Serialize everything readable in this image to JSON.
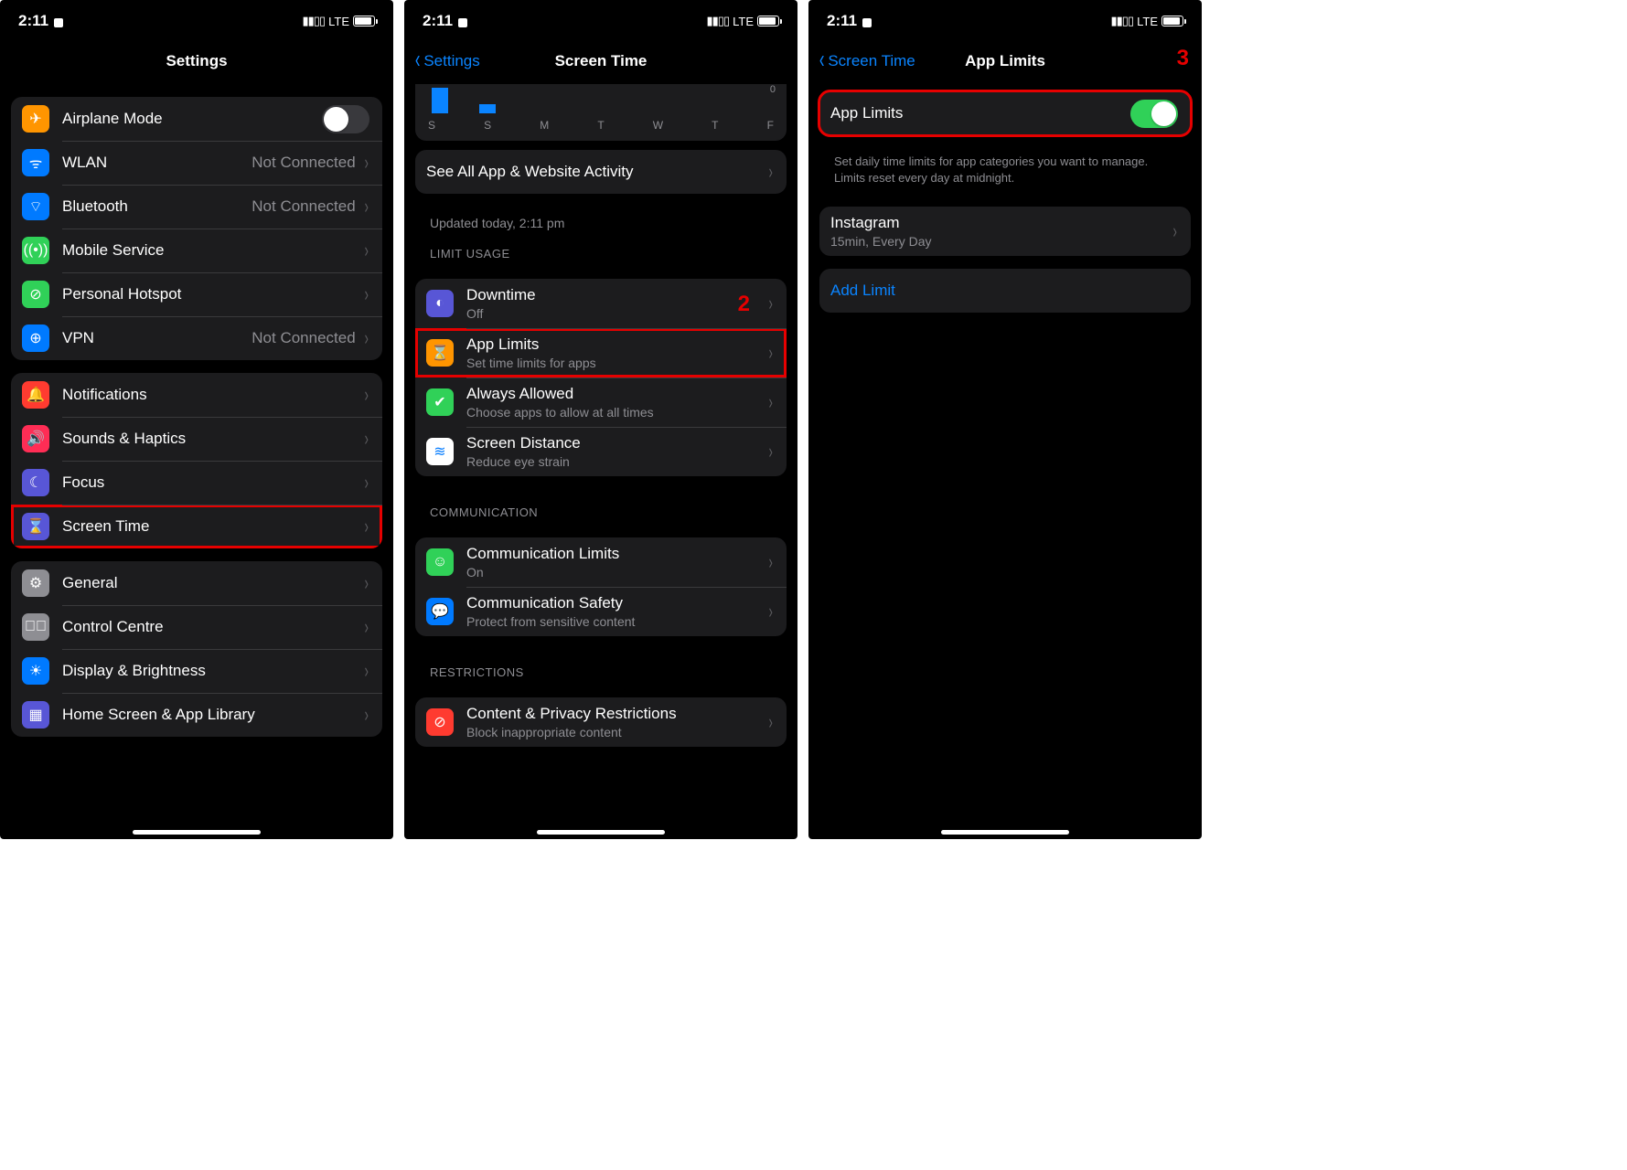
{
  "status": {
    "time": "2:11",
    "network": "LTE"
  },
  "screen1": {
    "title": "Settings",
    "group1": [
      {
        "icon": "airplane",
        "color": "#ff9500",
        "label": "Airplane Mode",
        "type": "toggle",
        "on": false
      },
      {
        "icon": "wifi",
        "color": "#007aff",
        "label": "WLAN",
        "value": "Not Connected"
      },
      {
        "icon": "bluetooth",
        "color": "#007aff",
        "label": "Bluetooth",
        "value": "Not Connected"
      },
      {
        "icon": "antenna",
        "color": "#30d158",
        "label": "Mobile Service"
      },
      {
        "icon": "link",
        "color": "#30d158",
        "label": "Personal Hotspot"
      },
      {
        "icon": "globe",
        "color": "#007aff",
        "label": "VPN",
        "value": "Not Connected"
      }
    ],
    "group2": [
      {
        "icon": "bell",
        "color": "#ff3b30",
        "label": "Notifications"
      },
      {
        "icon": "speaker",
        "color": "#ff2d55",
        "label": "Sounds & Haptics"
      },
      {
        "icon": "moon",
        "color": "#5856d6",
        "label": "Focus"
      },
      {
        "icon": "hourglass",
        "color": "#5856d6",
        "label": "Screen Time",
        "highlight": true
      }
    ],
    "group3": [
      {
        "icon": "gear",
        "color": "#8e8e93",
        "label": "General"
      },
      {
        "icon": "switches",
        "color": "#8e8e93",
        "label": "Control Centre"
      },
      {
        "icon": "sun",
        "color": "#007aff",
        "label": "Display & Brightness"
      },
      {
        "icon": "grid",
        "color": "#5856d6",
        "label": "Home Screen & App Library"
      }
    ]
  },
  "screen2": {
    "back": "Settings",
    "title": "Screen Time",
    "see_all": "See All App & Website Activity",
    "updated": "Updated today, 2:11 pm",
    "limit_header": "LIMIT USAGE",
    "limit_rows": [
      {
        "icon": "clock",
        "color": "#5856d6",
        "bg": "#5856d6",
        "label": "Downtime",
        "sub": "Off"
      },
      {
        "icon": "hourglass",
        "color": "#ff9500",
        "label": "App Limits",
        "sub": "Set time limits for apps",
        "highlight": true
      },
      {
        "icon": "check",
        "color": "#30d158",
        "label": "Always Allowed",
        "sub": "Choose apps to allow at all times"
      },
      {
        "icon": "distance",
        "color": "#ffffff",
        "label": "Screen Distance",
        "sub": "Reduce eye strain"
      }
    ],
    "comm_header": "COMMUNICATION",
    "comm_rows": [
      {
        "icon": "person",
        "color": "#30d158",
        "label": "Communication Limits",
        "sub": "On"
      },
      {
        "icon": "bubble",
        "color": "#007aff",
        "label": "Communication Safety",
        "sub": "Protect from sensitive content"
      }
    ],
    "restr_header": "RESTRICTIONS",
    "restr_rows": [
      {
        "icon": "no",
        "color": "#ff3b30",
        "label": "Content & Privacy Restrictions",
        "sub": "Block inappropriate content"
      }
    ],
    "annot": "2",
    "days": [
      "S",
      "S",
      "M",
      "T",
      "W",
      "T",
      "F"
    ]
  },
  "screen3": {
    "back": "Screen Time",
    "title": "App Limits",
    "toggle_label": "App Limits",
    "footer": "Set daily time limits for app categories you want to manage. Limits reset every day at midnight.",
    "limits": [
      {
        "label": "Instagram",
        "sub": "15min, Every Day"
      }
    ],
    "add_limit": "Add Limit",
    "annot": "3"
  }
}
